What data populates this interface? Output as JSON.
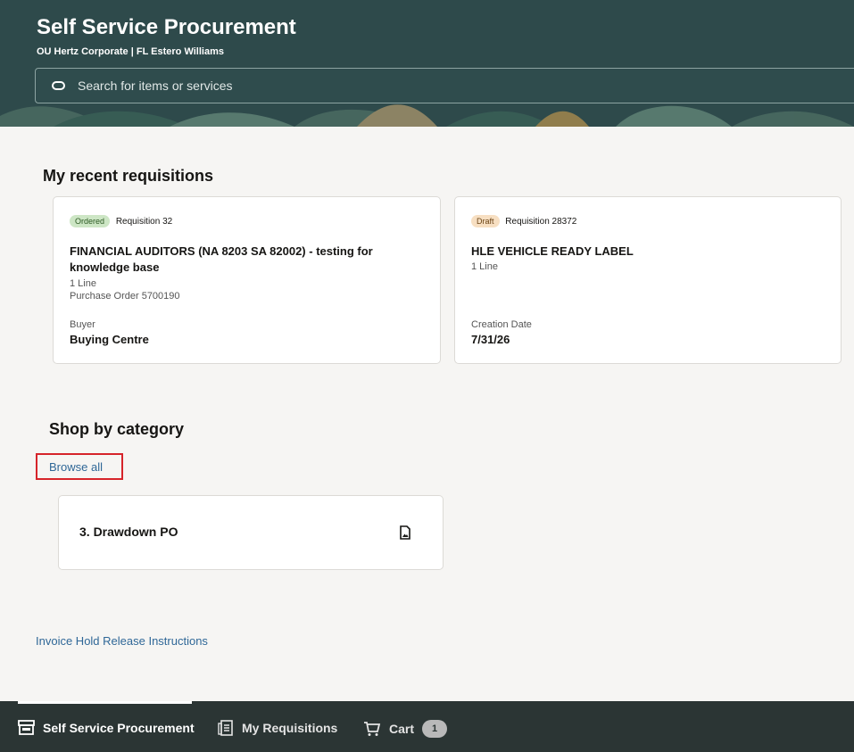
{
  "header": {
    "title": "Self Service Procurement",
    "subtitle": "OU Hertz Corporate | FL Estero Williams",
    "search_placeholder": "Search for items or services"
  },
  "recent": {
    "title": "My recent requisitions",
    "cards": [
      {
        "status": "Ordered",
        "requisition": "Requisition 32",
        "name": "FINANCIAL AUDITORS (NA 8203 SA 82002) - testing for knowledge base",
        "lines": "1 Line",
        "po": "Purchase Order 5700190",
        "field_label": "Buyer",
        "field_value": "Buying Centre"
      },
      {
        "status": "Draft",
        "requisition": "Requisition 28372",
        "name": "HLE VEHICLE READY LABEL",
        "lines": "1 Line",
        "field_label": "Creation Date",
        "field_value": "7/31/26"
      }
    ]
  },
  "shop": {
    "title": "Shop by category",
    "browse_all": "Browse all",
    "categories": [
      {
        "name": "3. Drawdown PO",
        "icon": "document-icon"
      }
    ]
  },
  "footer_link": "Invoice Hold Release Instructions",
  "bottom_nav": {
    "items": [
      {
        "label": "Self Service Procurement",
        "icon": "store-icon",
        "active": true
      },
      {
        "label": "My Requisitions",
        "icon": "clipboard-icon",
        "active": false
      },
      {
        "label": "Cart",
        "icon": "cart-icon",
        "active": false
      }
    ],
    "cart_count": "1"
  },
  "colors": {
    "header_bg": "#2e4a4b",
    "bottom_bg": "#2b3534",
    "link": "#2f6797",
    "highlight": "#d6242a"
  }
}
